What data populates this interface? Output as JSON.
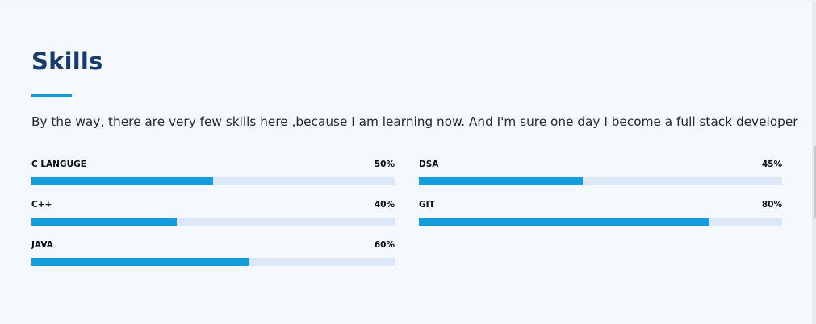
{
  "section": {
    "title": "Skills",
    "description": "By the way, there are very few skills here ,because I am learning now. And I'm sure one day I become a full stack developer"
  },
  "skills": [
    {
      "name": "C LANGUGE",
      "percent_label": "50%",
      "value": 50
    },
    {
      "name": "DSA",
      "percent_label": "45%",
      "value": 45
    },
    {
      "name": "C++",
      "percent_label": "40%",
      "value": 40
    },
    {
      "name": "GIT",
      "percent_label": "80%",
      "value": 80
    },
    {
      "name": "JAVA",
      "percent_label": "60%",
      "value": 60
    }
  ],
  "colors": {
    "accent": "#149ddd",
    "track": "#dce8f8",
    "heading": "#173b6c",
    "background": "#f5f8fd"
  }
}
